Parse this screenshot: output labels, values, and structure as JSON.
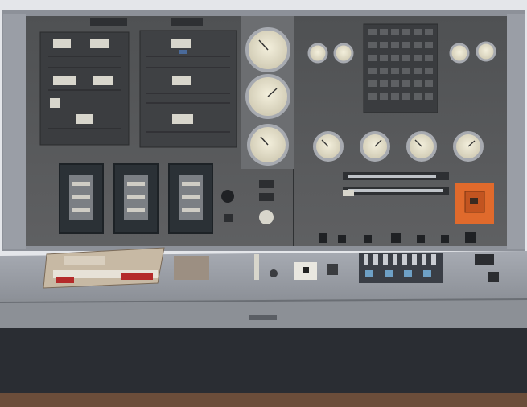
{
  "image": {
    "subject": "control-console",
    "palette": {
      "panel": "#595a5c",
      "panel_dark": "#3f4043",
      "frame": "#8b8f97",
      "desk": "#8c9096",
      "desk_top": "#a4a8b0",
      "base": "#2a2d33",
      "floor": "#6b4d3a",
      "gauge_face": "#e9e4cf",
      "gauge_rim": "#a7aab0",
      "indicator": "#d8d6cc",
      "orange_panel": "#e06a2c",
      "label_red": "#b42a2a"
    }
  }
}
